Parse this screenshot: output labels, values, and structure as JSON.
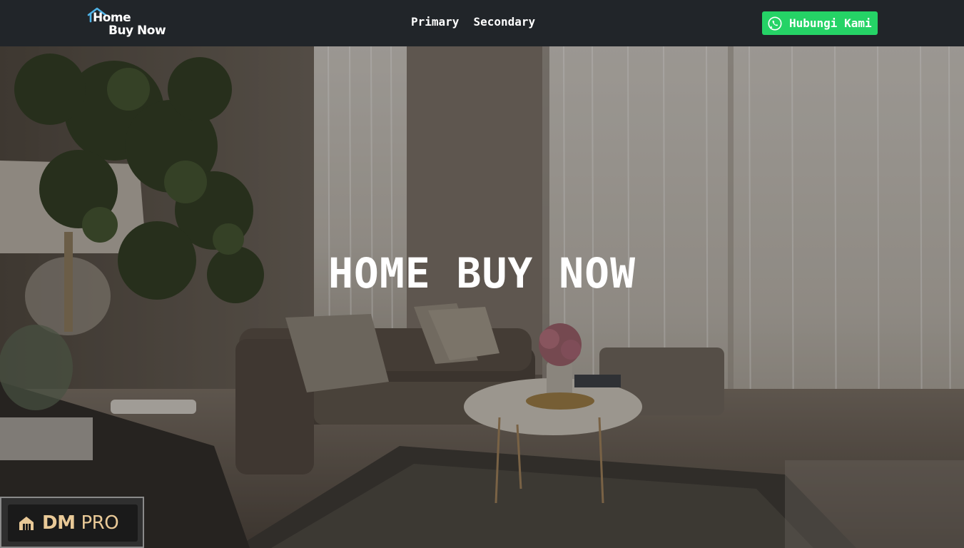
{
  "brand": {
    "logo_line1": "Home",
    "logo_line2": "Buy Now",
    "accent_color": "#4fb3e8"
  },
  "nav": {
    "items": [
      {
        "label": "Primary"
      },
      {
        "label": "Secondary"
      }
    ]
  },
  "cta": {
    "label": "Hubungi Kami",
    "icon": "whatsapp-icon",
    "color": "#25d366"
  },
  "hero": {
    "title": "HOME BUY NOW"
  },
  "badge": {
    "text_bold": "DM",
    "text_light": "PRO",
    "color": "#e9c997"
  }
}
